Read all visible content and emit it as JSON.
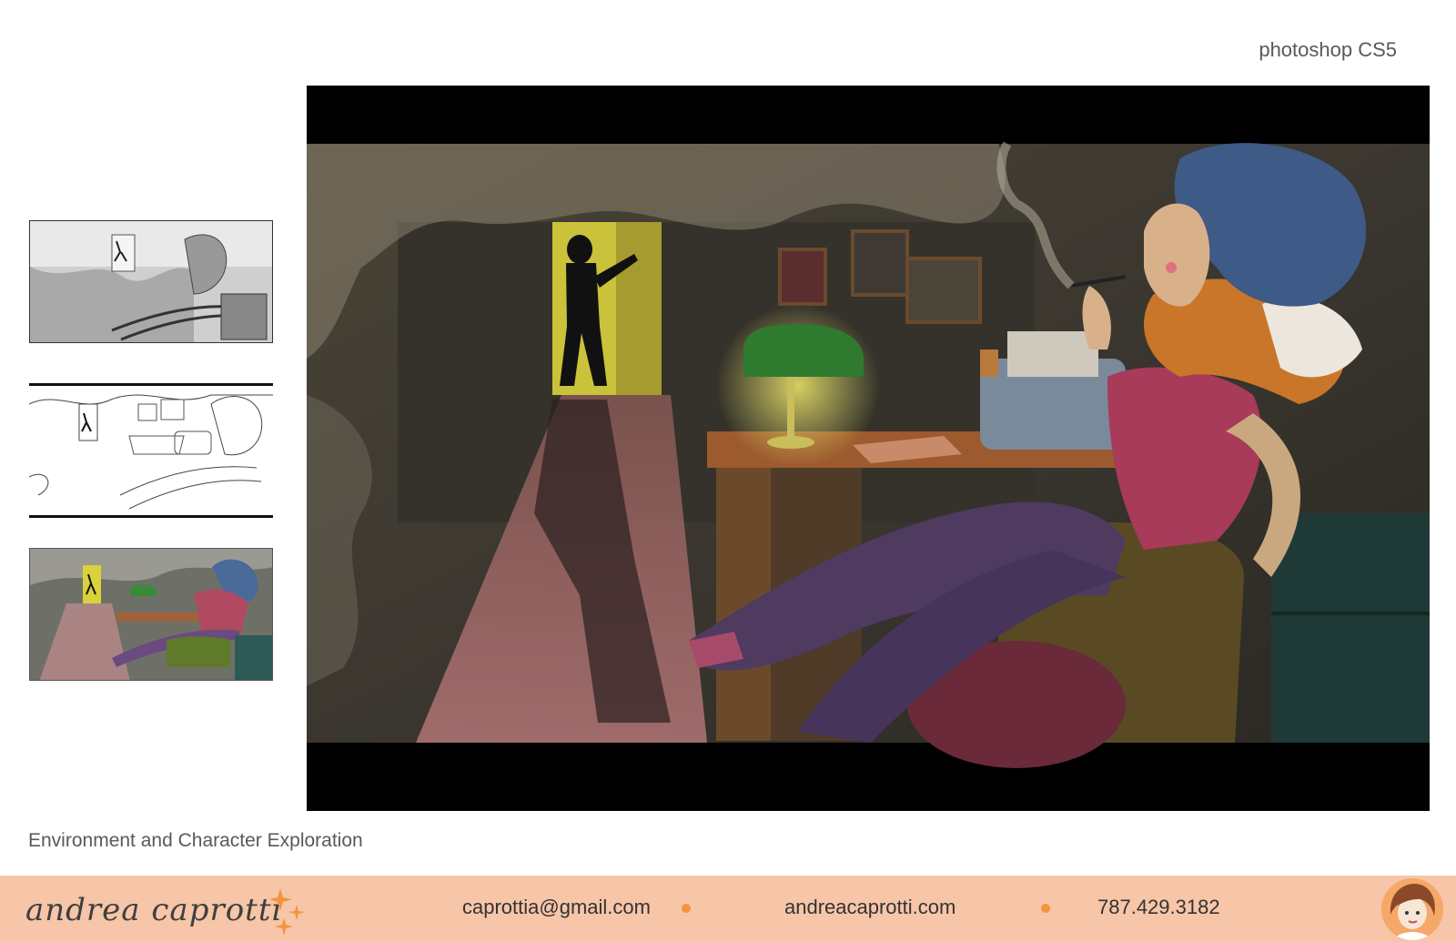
{
  "header": {
    "software": "photoshop CS5"
  },
  "caption": "Environment and Character Exploration",
  "footer": {
    "signature": "andrea caprotti",
    "email": "caprottia@gmail.com",
    "website": "andreacaprotti.com",
    "phone": "787.429.3182",
    "accent_color": "#f2953d",
    "background_color": "#f7c5a8"
  }
}
